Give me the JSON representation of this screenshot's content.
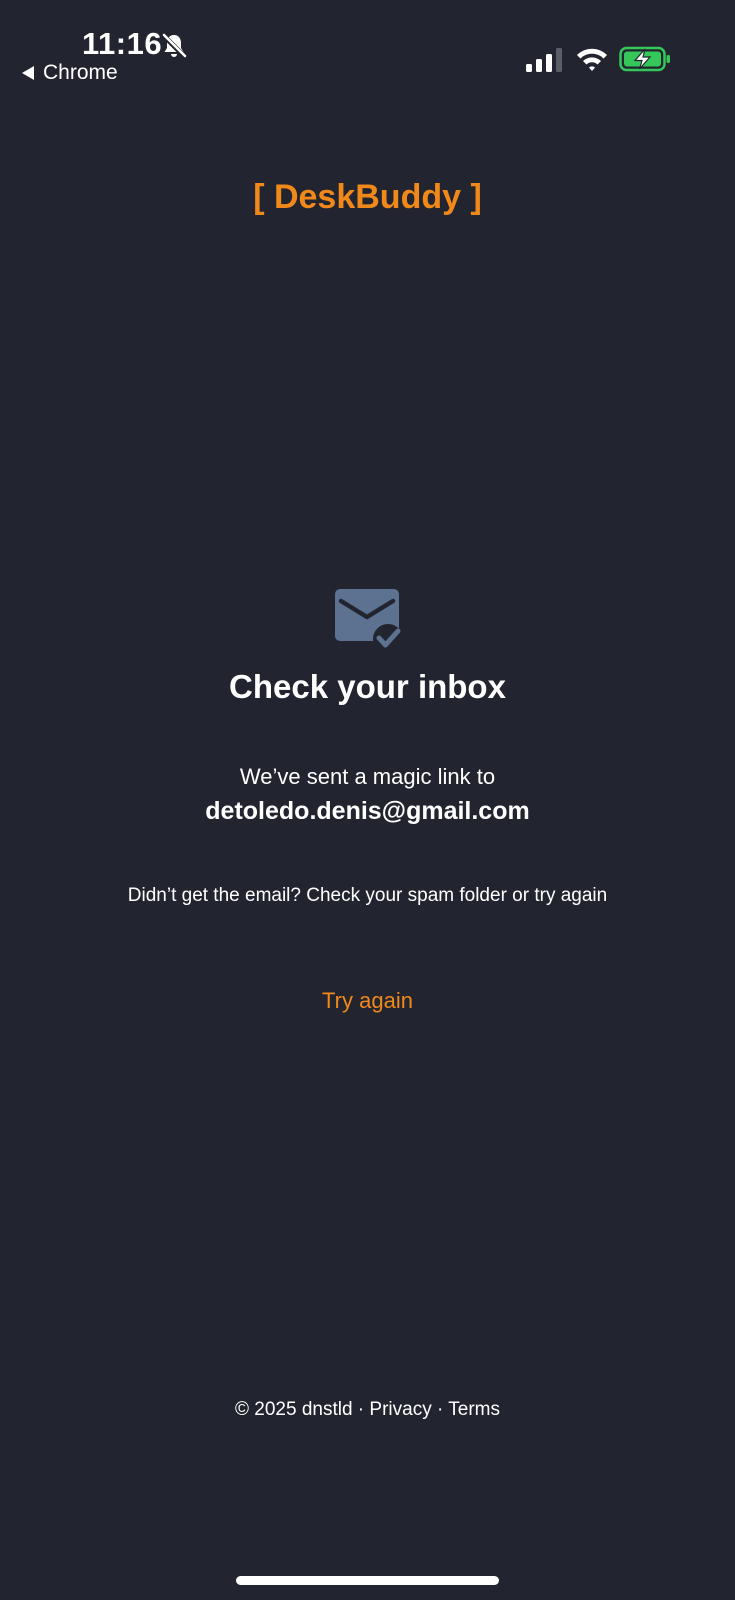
{
  "status_bar": {
    "time": "11:16",
    "back_app": "Chrome",
    "icons": [
      "bell-off-icon",
      "signal-icon",
      "wifi-icon",
      "battery-charging-icon"
    ],
    "battery_color": "#34c759"
  },
  "brand": {
    "name": "[ DeskBuddy ]",
    "color": "#f0891a"
  },
  "main": {
    "icon": "mail-check-icon",
    "heading": "Check your inbox",
    "sent_line": "We’ve sent a magic link to",
    "email": "detoledo.denis@gmail.com",
    "hint": "Didn’t get the email? Check your spam folder or try again",
    "try_again_label": "Try again"
  },
  "footer": {
    "copyright": "© 2025 dnstld",
    "separator": " · ",
    "privacy_label": "Privacy",
    "terms_label": "Terms"
  },
  "colors": {
    "background": "#22252f",
    "accent": "#f0891a",
    "icon": "#5d7190"
  }
}
